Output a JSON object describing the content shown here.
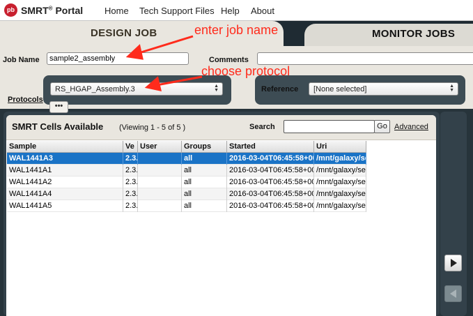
{
  "app": {
    "logo_text": "pb",
    "title": "SMRT",
    "title_reg": "®",
    "title_suffix": " Portal"
  },
  "menu": [
    "Home",
    "Tech Support Files",
    "Help",
    "About"
  ],
  "tabs": {
    "design": "DESIGN JOB",
    "monitor": "MONITOR JOBS"
  },
  "form": {
    "job_name_label": "Job Name",
    "job_name_value": "sample2_assembly",
    "comments_label": "Comments",
    "comments_value": "",
    "protocols_label": "Protocols",
    "protocol_selected": "RS_HGAP_Assembly.3",
    "reference_label": "Reference",
    "reference_selected": "[None selected]",
    "more_button": "•••"
  },
  "cells_panel": {
    "title": "SMRT Cells Available",
    "viewing": "(Viewing 1 - 5 of 5 )",
    "search_label": "Search",
    "search_value": "",
    "go_label": "Go",
    "advanced_label": "Advanced",
    "columns": [
      "Sample",
      "Ve",
      "User",
      "Groups",
      "Started",
      "Uri"
    ],
    "rows": [
      {
        "sample": "WAL1441A3",
        "ver": "2.3.",
        "user": "",
        "groups": "all",
        "started": "2016-03-04T06:45:58+00",
        "uri": "/mnt/galaxy/se",
        "selected": true
      },
      {
        "sample": "WAL1441A1",
        "ver": "2.3.",
        "user": "",
        "groups": "all",
        "started": "2016-03-04T06:45:58+00",
        "uri": "/mnt/galaxy/se",
        "selected": false
      },
      {
        "sample": "WAL1441A2",
        "ver": "2.3.",
        "user": "",
        "groups": "all",
        "started": "2016-03-04T06:45:58+00",
        "uri": "/mnt/galaxy/se",
        "selected": false
      },
      {
        "sample": "WAL1441A4",
        "ver": "2.3.",
        "user": "",
        "groups": "all",
        "started": "2016-03-04T06:45:58+00",
        "uri": "/mnt/galaxy/se",
        "selected": false
      },
      {
        "sample": "WAL1441A5",
        "ver": "2.3.",
        "user": "",
        "groups": "all",
        "started": "2016-03-04T06:45:58+00",
        "uri": "/mnt/galaxy/se",
        "selected": false
      }
    ]
  },
  "side_buttons": {
    "add_icon": "play-right-icon",
    "remove_icon": "play-left-icon"
  },
  "annotations": {
    "job_name": "enter job name",
    "protocol": "choose protocol"
  },
  "colors": {
    "annotation": "#ff2b1c",
    "selection": "#1a73c6",
    "logo": "#c8202f"
  }
}
